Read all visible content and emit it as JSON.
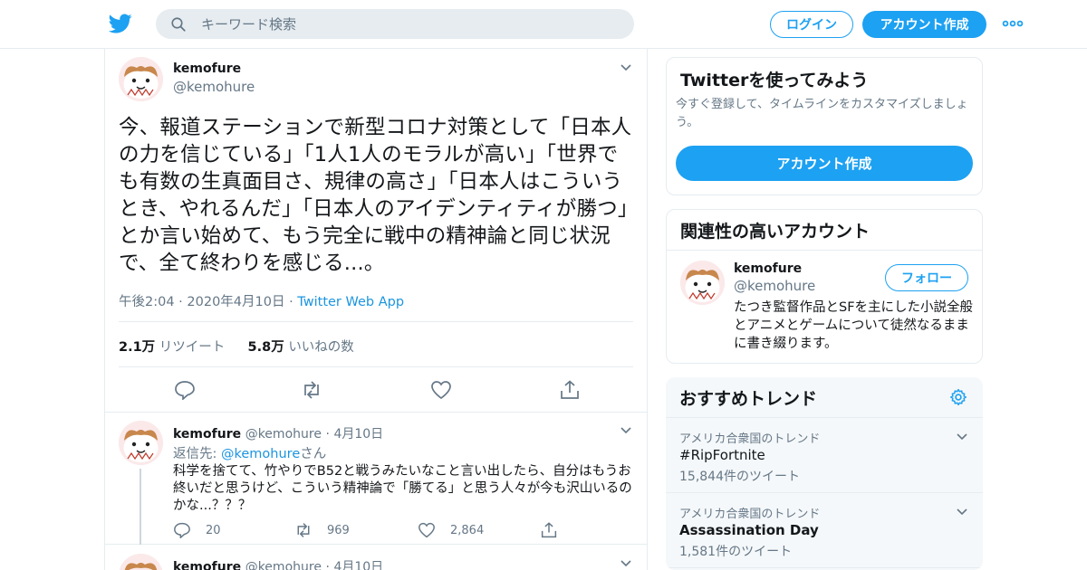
{
  "header": {
    "search_placeholder": "キーワード検索",
    "login_label": "ログイン",
    "signup_label": "アカウント作成"
  },
  "main_tweet": {
    "name": "kemofure",
    "handle": "@kemohure",
    "text": "今、報道ステーションで新型コロナ対策として「日本人の力を信じている」「1人1人のモラルが高い」「世界でも有数の生真面目さ、規律の高さ」「日本人はこういうとき、やれるんだ」「日本人のアイデンティティが勝つ」とか言い始めて、もう完全に戦中の精神論と同じ状況で、全て終わりを感じる...。",
    "time": "午後2:04 · 2020年4月10日",
    "sep": "·",
    "source": "Twitter Web App",
    "retweets_count": "2.1万",
    "retweets_label": "リツイート",
    "likes_count": "5.8万",
    "likes_label": "いいねの数"
  },
  "replies": [
    {
      "name": "kemofure",
      "handle": "@kemohure",
      "date": "· 4月10日",
      "reply_prefix": "返信先:",
      "reply_to": "@kemohure",
      "reply_suffix": "さん",
      "text": "科学を捨てて、竹やりでB52と戦うみたいなこと言い出したら、自分はもうお終いだと思うけど、こういう精神論で「勝てる」と思う人々が今も沢山いるのかな...？？？",
      "replies": "20",
      "retweets": "969",
      "likes": "2,864"
    },
    {
      "name": "kemofure",
      "handle": "@kemohure",
      "date": "· 4月10日"
    }
  ],
  "signup_card": {
    "title": "Twitterを使ってみよう",
    "description": "今すぐ登録して、タイムラインをカスタマイズしましょう。",
    "button": "アカウント作成"
  },
  "related": {
    "title": "関連性の高いアカウント",
    "name": "kemofure",
    "handle": "@kemohure",
    "follow_label": "フォロー",
    "bio": "たつき監督作品とSFを主にした小説全般とアニメとゲームについて徒然なるままに書き綴ります。"
  },
  "trends": {
    "title": "おすすめトレンド",
    "items": [
      {
        "location": "アメリカ合衆国のトレンド",
        "name": "#RipFortnite",
        "count": "15,844件のツイート"
      },
      {
        "location": "アメリカ合衆国のトレンド",
        "name": "Assassination Day",
        "count": "1,581件のツイート"
      }
    ]
  },
  "colors": {
    "accent": "#1da1f2",
    "link": "#1b95e0",
    "secondary_text": "#657786",
    "border": "#e6ecf0"
  }
}
